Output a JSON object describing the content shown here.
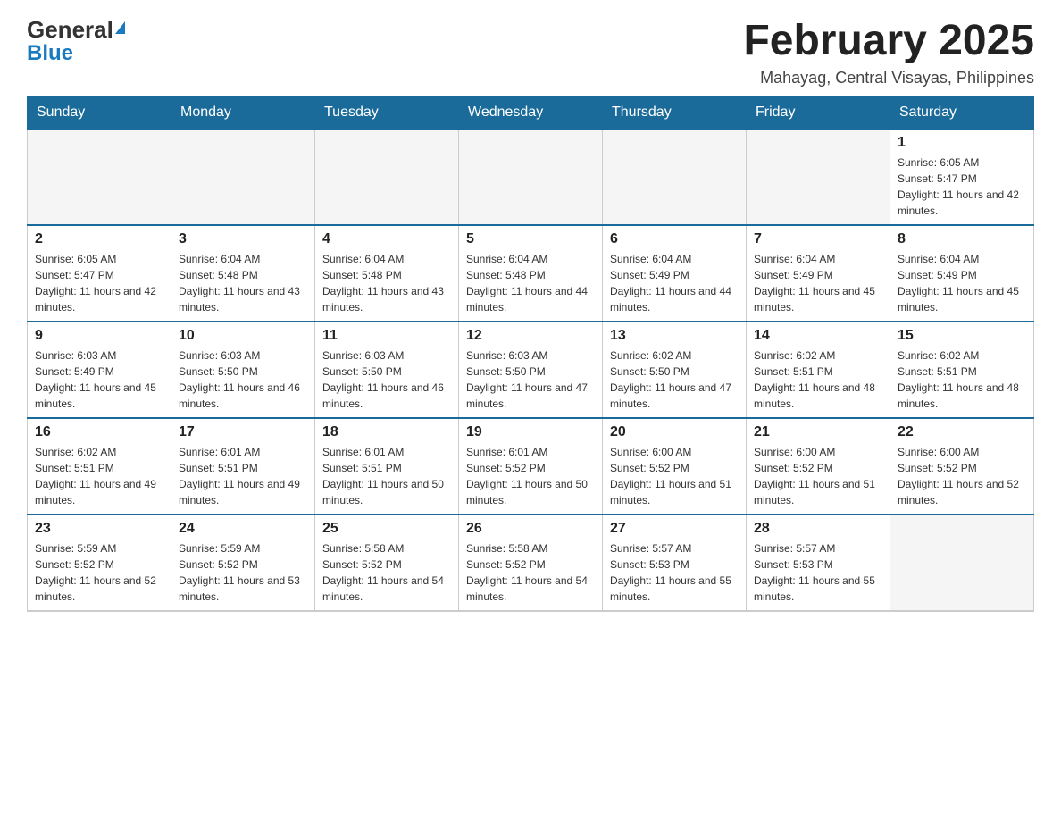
{
  "header": {
    "logo_general": "General",
    "logo_blue": "Blue",
    "title": "February 2025",
    "subtitle": "Mahayag, Central Visayas, Philippines"
  },
  "days_of_week": [
    "Sunday",
    "Monday",
    "Tuesday",
    "Wednesday",
    "Thursday",
    "Friday",
    "Saturday"
  ],
  "weeks": [
    [
      {
        "num": "",
        "info": ""
      },
      {
        "num": "",
        "info": ""
      },
      {
        "num": "",
        "info": ""
      },
      {
        "num": "",
        "info": ""
      },
      {
        "num": "",
        "info": ""
      },
      {
        "num": "",
        "info": ""
      },
      {
        "num": "1",
        "info": "Sunrise: 6:05 AM\nSunset: 5:47 PM\nDaylight: 11 hours and 42 minutes."
      }
    ],
    [
      {
        "num": "2",
        "info": "Sunrise: 6:05 AM\nSunset: 5:47 PM\nDaylight: 11 hours and 42 minutes."
      },
      {
        "num": "3",
        "info": "Sunrise: 6:04 AM\nSunset: 5:48 PM\nDaylight: 11 hours and 43 minutes."
      },
      {
        "num": "4",
        "info": "Sunrise: 6:04 AM\nSunset: 5:48 PM\nDaylight: 11 hours and 43 minutes."
      },
      {
        "num": "5",
        "info": "Sunrise: 6:04 AM\nSunset: 5:48 PM\nDaylight: 11 hours and 44 minutes."
      },
      {
        "num": "6",
        "info": "Sunrise: 6:04 AM\nSunset: 5:49 PM\nDaylight: 11 hours and 44 minutes."
      },
      {
        "num": "7",
        "info": "Sunrise: 6:04 AM\nSunset: 5:49 PM\nDaylight: 11 hours and 45 minutes."
      },
      {
        "num": "8",
        "info": "Sunrise: 6:04 AM\nSunset: 5:49 PM\nDaylight: 11 hours and 45 minutes."
      }
    ],
    [
      {
        "num": "9",
        "info": "Sunrise: 6:03 AM\nSunset: 5:49 PM\nDaylight: 11 hours and 45 minutes."
      },
      {
        "num": "10",
        "info": "Sunrise: 6:03 AM\nSunset: 5:50 PM\nDaylight: 11 hours and 46 minutes."
      },
      {
        "num": "11",
        "info": "Sunrise: 6:03 AM\nSunset: 5:50 PM\nDaylight: 11 hours and 46 minutes."
      },
      {
        "num": "12",
        "info": "Sunrise: 6:03 AM\nSunset: 5:50 PM\nDaylight: 11 hours and 47 minutes."
      },
      {
        "num": "13",
        "info": "Sunrise: 6:02 AM\nSunset: 5:50 PM\nDaylight: 11 hours and 47 minutes."
      },
      {
        "num": "14",
        "info": "Sunrise: 6:02 AM\nSunset: 5:51 PM\nDaylight: 11 hours and 48 minutes."
      },
      {
        "num": "15",
        "info": "Sunrise: 6:02 AM\nSunset: 5:51 PM\nDaylight: 11 hours and 48 minutes."
      }
    ],
    [
      {
        "num": "16",
        "info": "Sunrise: 6:02 AM\nSunset: 5:51 PM\nDaylight: 11 hours and 49 minutes."
      },
      {
        "num": "17",
        "info": "Sunrise: 6:01 AM\nSunset: 5:51 PM\nDaylight: 11 hours and 49 minutes."
      },
      {
        "num": "18",
        "info": "Sunrise: 6:01 AM\nSunset: 5:51 PM\nDaylight: 11 hours and 50 minutes."
      },
      {
        "num": "19",
        "info": "Sunrise: 6:01 AM\nSunset: 5:52 PM\nDaylight: 11 hours and 50 minutes."
      },
      {
        "num": "20",
        "info": "Sunrise: 6:00 AM\nSunset: 5:52 PM\nDaylight: 11 hours and 51 minutes."
      },
      {
        "num": "21",
        "info": "Sunrise: 6:00 AM\nSunset: 5:52 PM\nDaylight: 11 hours and 51 minutes."
      },
      {
        "num": "22",
        "info": "Sunrise: 6:00 AM\nSunset: 5:52 PM\nDaylight: 11 hours and 52 minutes."
      }
    ],
    [
      {
        "num": "23",
        "info": "Sunrise: 5:59 AM\nSunset: 5:52 PM\nDaylight: 11 hours and 52 minutes."
      },
      {
        "num": "24",
        "info": "Sunrise: 5:59 AM\nSunset: 5:52 PM\nDaylight: 11 hours and 53 minutes."
      },
      {
        "num": "25",
        "info": "Sunrise: 5:58 AM\nSunset: 5:52 PM\nDaylight: 11 hours and 54 minutes."
      },
      {
        "num": "26",
        "info": "Sunrise: 5:58 AM\nSunset: 5:52 PM\nDaylight: 11 hours and 54 minutes."
      },
      {
        "num": "27",
        "info": "Sunrise: 5:57 AM\nSunset: 5:53 PM\nDaylight: 11 hours and 55 minutes."
      },
      {
        "num": "28",
        "info": "Sunrise: 5:57 AM\nSunset: 5:53 PM\nDaylight: 11 hours and 55 minutes."
      },
      {
        "num": "",
        "info": ""
      }
    ]
  ]
}
